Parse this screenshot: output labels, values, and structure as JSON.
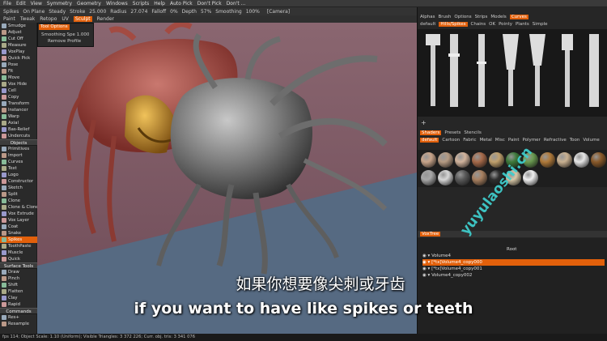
{
  "menubar": [
    "File",
    "Edit",
    "View",
    "Symmetry",
    "Geometry",
    "Windows",
    "Scripts",
    "Help",
    "Auto Pick",
    "Don't Pick",
    "Don't ..."
  ],
  "toolbar": {
    "items": [
      "Spikes",
      "On Plane",
      "Steady",
      "Stroke",
      "25.000",
      "Radius",
      "27.074",
      "Falloff",
      "0%",
      "Depth",
      "57%",
      "Smoothing",
      "100%"
    ],
    "camera": "[Camera]"
  },
  "room_tabs": [
    "Paint",
    "Tweak",
    "Retopo",
    "UV",
    "Sculpt",
    "Render"
  ],
  "active_room": "Sculpt",
  "left_panel": {
    "items_top": [
      "Smudge",
      "Adjust",
      "Cut Off",
      "Measure",
      "VoxPlay",
      "Quick Pick",
      "Pose",
      "Fit",
      "Move",
      "Vox Hide",
      "Cell",
      "Copy",
      "Transform",
      "Instancer",
      "Warp",
      "Axial",
      "Bas-Relief",
      "Undercuts"
    ],
    "objects_header": "Objects",
    "items_objects": [
      "Primitives",
      "Import",
      "Curves",
      "Text",
      "Logo",
      "Constructor",
      "Sketch",
      "Split",
      "Clone",
      "Clone & Clone",
      "Vox Extrude",
      "Vox Layer",
      "Coat",
      "Snake",
      "Spikes",
      "ToothPaste",
      "Muscle",
      "Quick"
    ],
    "surface_header": "Surface Tools",
    "items_surface": [
      "Draw",
      "Pinch",
      "Shift",
      "Flatten",
      "Clay",
      "Rapid"
    ],
    "commands_header": "Commands",
    "items_commands": [
      "Res+",
      "Resample"
    ],
    "selected": "Spikes"
  },
  "tool_options": {
    "tab": "Tool Options",
    "smoothing_label": "Smoothing Spe",
    "smoothing_value": "1.000",
    "remove_button": "Remove Profile"
  },
  "right_panel": {
    "top_tabs": [
      "Alphas",
      "Brush",
      "Options",
      "Strips",
      "Models",
      "Curves"
    ],
    "active_top": "Curves",
    "curve_subtabs": [
      "default",
      "Hills/Spikes",
      "Chains",
      "OK",
      "Pointy",
      "Plants",
      "Simple"
    ],
    "active_curve_subtab": "Hills/Spikes",
    "shader_tabs": [
      "Shaders",
      "Presets",
      "Stencils"
    ],
    "shader_subtabs": [
      "default",
      "Cartoon",
      "Fabric",
      "Metal",
      "Misc",
      "Paint",
      "Polymer",
      "Refractive",
      "Toon",
      "Volume"
    ],
    "voxtree_tab": "VoxTree",
    "voxtree_header": "Root",
    "voxtree_rows": [
      "Volume4",
      "[*tx]Volume4_copy000",
      "[*tx]Volume4_copy001",
      "Volume4_copy002"
    ],
    "selected_row": "[*tx]Volume4_copy000"
  },
  "status_bar": "fps 114;   Object Scale: 1.10 (Uniform);  Visible Triangles: 3 372 226;  Curr. obj. tris: 3 341 076",
  "subtitle_cn": "如果你想要像尖刺或牙齿",
  "subtitle_en": "if you want to have like spikes or teeth",
  "watermark": "yuyulaoshi.cn",
  "colors": {
    "accent": "#e2600b",
    "viewport_bg": "#7a5560",
    "watermark": "#3fd0cf"
  }
}
